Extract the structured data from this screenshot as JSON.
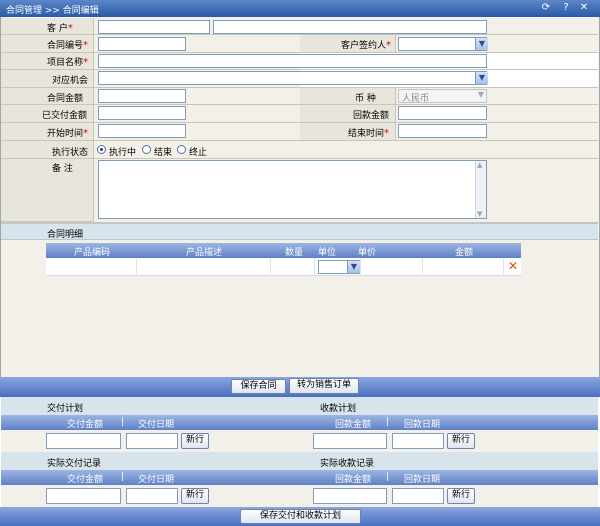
{
  "window": {
    "breadcrumb": "合同管理 >> 合同编辑"
  },
  "form": {
    "customer_label": "客    户",
    "contract_no_label": "合同编号",
    "customer_signer_label": "客户签约人",
    "project_name_label": "项目名称",
    "opportunity_label": "对应机会",
    "contract_amount_label": "合同金额",
    "currency_label": "币    种",
    "currency_value": "人民币",
    "delivered_amount_label": "已交付金额",
    "received_amount_label": "回款金额",
    "start_time_label": "开始时间",
    "end_time_label": "结束时间",
    "status_label": "执行状态",
    "status_options": [
      "执行中",
      "结束",
      "终止"
    ],
    "status_selected": "执行中",
    "remarks_label": "备    注",
    "required_mark": "*"
  },
  "detail": {
    "section_title": "合同明细",
    "columns": [
      "产品编码",
      "产品描述",
      "数量",
      "单位",
      "单价",
      "金额"
    ]
  },
  "actions": {
    "save_contract": "保存合同",
    "to_sales_order": "转为销售订单",
    "save_plans": "保存交付和收款计划"
  },
  "plans": {
    "delivery_plan_title": "交付计划",
    "receipt_plan_title": "收款计划",
    "delivery_amount_col": "交付金额",
    "delivery_date_col": "交付日期",
    "receipt_amount_col": "回款金额",
    "receipt_date_col": "回款日期",
    "new_row": "新行",
    "actual_delivery_title": "实际交付记录",
    "actual_receipt_title": "实际收款记录"
  }
}
